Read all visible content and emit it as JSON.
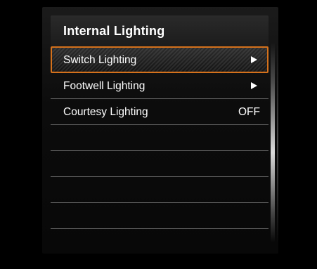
{
  "menu": {
    "title": "Internal Lighting",
    "items": [
      {
        "label": "Switch Lighting",
        "value": "",
        "has_arrow": true,
        "selected": true
      },
      {
        "label": "Footwell Lighting",
        "value": "",
        "has_arrow": true,
        "selected": false
      },
      {
        "label": "Courtesy Lighting",
        "value": "OFF",
        "has_arrow": false,
        "selected": false
      },
      {
        "label": "",
        "value": "",
        "has_arrow": false,
        "selected": false
      },
      {
        "label": "",
        "value": "",
        "has_arrow": false,
        "selected": false
      },
      {
        "label": "",
        "value": "",
        "has_arrow": false,
        "selected": false
      },
      {
        "label": "",
        "value": "",
        "has_arrow": false,
        "selected": false
      }
    ]
  },
  "colors": {
    "selection_border": "#d4711c",
    "background": "#000000",
    "text": "#ffffff"
  },
  "icons": {
    "submenu": "chevron-right-icon",
    "scrollbar": "scrollbar"
  }
}
